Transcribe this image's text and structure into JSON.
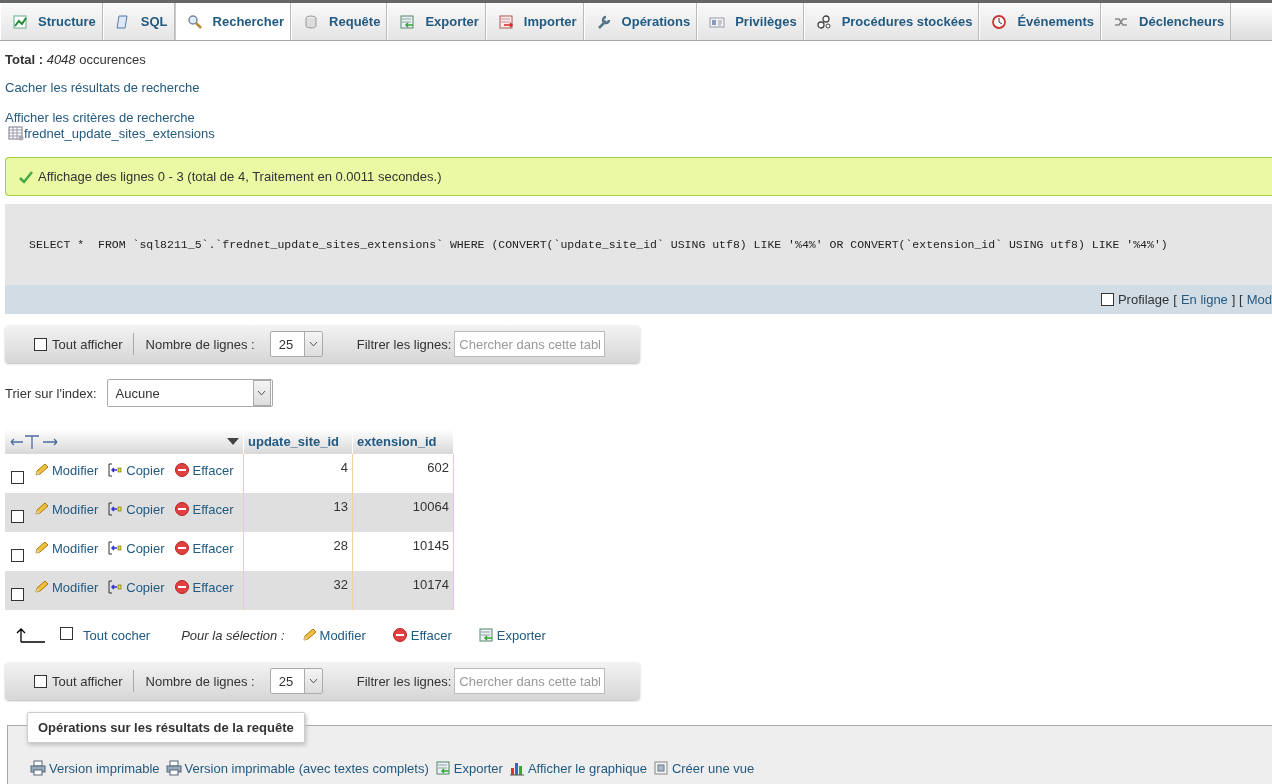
{
  "tabs": [
    {
      "kind": "structure",
      "label": "Structure",
      "selected": false
    },
    {
      "kind": "sql",
      "label": "SQL",
      "selected": false
    },
    {
      "kind": "search",
      "label": "Rechercher",
      "selected": true
    },
    {
      "kind": "query",
      "label": "Requête",
      "selected": false
    },
    {
      "kind": "export",
      "label": "Exporter",
      "selected": false
    },
    {
      "kind": "import",
      "label": "Importer",
      "selected": false
    },
    {
      "kind": "operations",
      "label": "Opérations",
      "selected": false
    },
    {
      "kind": "privileges",
      "label": "Privilèges",
      "selected": false
    },
    {
      "kind": "routines",
      "label": "Procédures stockées",
      "selected": false
    },
    {
      "kind": "events",
      "label": "Événements",
      "selected": false
    },
    {
      "kind": "triggers",
      "label": "Déclencheurs",
      "selected": false
    }
  ],
  "summary": "**Total :** *4048* occurences",
  "hide_results_link": "Cacher les résultats de recherche",
  "show_criteria_link": "Afficher les critères de recherche",
  "table_link": "frednet_update_sites_extensions",
  "success_message": "Affichage des lignes 0 - 3 (total de 4, Traitement en 0.0011 secondes.)",
  "sql_query": "SELECT *  FROM `sql8211_5`.`frednet_update_sites_extensions` WHERE (CONVERT(`update_site_id` USING utf8) LIKE '%4%' OR CONVERT(`extension_id` USING utf8) LIKE '%4%')",
  "profiling": {
    "label": "Profilage",
    "checked": false,
    "parts": [
      {
        "kind": "text",
        "text": "["
      },
      {
        "kind": "link",
        "text": "En ligne"
      },
      {
        "kind": "text",
        "text": "] ["
      },
      {
        "kind": "link",
        "text": "Mod"
      }
    ]
  },
  "navbars": [
    {
      "show_all": {
        "label": "Tout afficher",
        "checked": false
      },
      "rows_label": "Nombre de lignes :",
      "rows_value": "25",
      "filter_label": "Filtrer les lignes:",
      "filter_placeholder": "Chercher dans cette tabl"
    },
    {
      "show_all": {
        "label": "Tout afficher",
        "checked": false
      },
      "rows_label": "Nombre de lignes :",
      "rows_value": "25",
      "filter_label": "Filtrer les lignes:",
      "filter_placeholder": "Chercher dans cette tabl"
    }
  ],
  "sort": {
    "label": "Trier sur l'index:",
    "value": "Aucune"
  },
  "table": {
    "columns": [
      "update_site_id",
      "extension_id"
    ],
    "rows": [
      {
        "selected": false,
        "actions": [
          {
            "kind": "edit",
            "label": "Modifier"
          },
          {
            "kind": "copy",
            "label": "Copier"
          },
          {
            "kind": "delete",
            "label": "Effacer"
          }
        ],
        "cells": [
          "4",
          "602"
        ]
      },
      {
        "selected": false,
        "actions": [
          {
            "kind": "edit",
            "label": "Modifier"
          },
          {
            "kind": "copy",
            "label": "Copier"
          },
          {
            "kind": "delete",
            "label": "Effacer"
          }
        ],
        "cells": [
          "13",
          "10064"
        ]
      },
      {
        "selected": false,
        "actions": [
          {
            "kind": "edit",
            "label": "Modifier"
          },
          {
            "kind": "copy",
            "label": "Copier"
          },
          {
            "kind": "delete",
            "label": "Effacer"
          }
        ],
        "cells": [
          "28",
          "10145"
        ]
      },
      {
        "selected": false,
        "actions": [
          {
            "kind": "edit",
            "label": "Modifier"
          },
          {
            "kind": "copy",
            "label": "Copier"
          },
          {
            "kind": "delete",
            "label": "Effacer"
          }
        ],
        "cells": [
          "32",
          "10174"
        ]
      }
    ]
  },
  "bulk": {
    "check_all": {
      "label": "Tout cocher",
      "checked": false
    },
    "with_selected": "Pour la sélection :",
    "actions": [
      {
        "kind": "edit",
        "label": "Modifier"
      },
      {
        "kind": "delete",
        "label": "Effacer"
      },
      {
        "kind": "export",
        "label": "Exporter"
      }
    ]
  },
  "operations": {
    "legend": "Opérations sur les résultats de la requête",
    "actions": [
      {
        "kind": "print",
        "label": "Version imprimable"
      },
      {
        "kind": "print",
        "label": "Version imprimable (avec textes complets)"
      },
      {
        "kind": "export",
        "label": "Exporter"
      },
      {
        "kind": "chart",
        "label": "Afficher le graphique"
      },
      {
        "kind": "view",
        "label": "Créer une vue"
      }
    ]
  }
}
